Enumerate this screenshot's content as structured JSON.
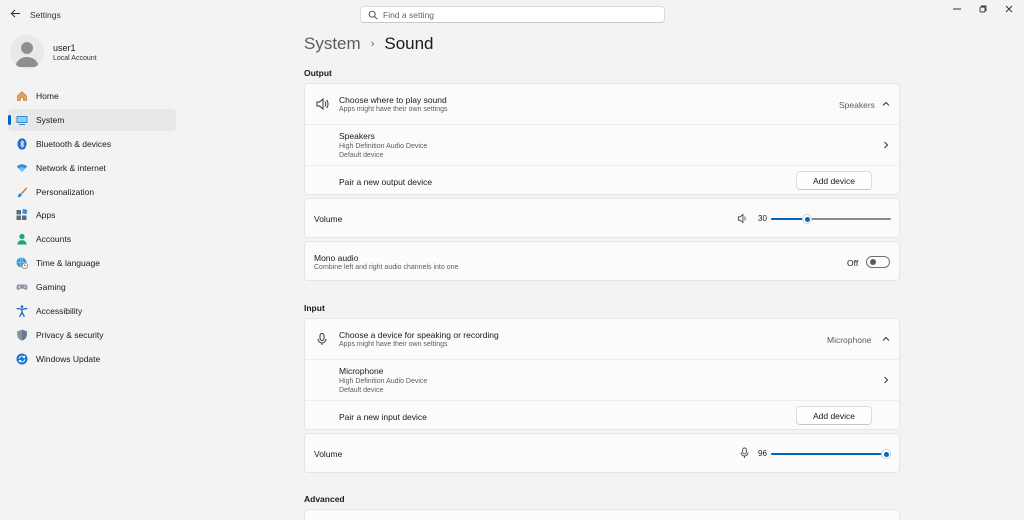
{
  "titlebar": {
    "app_title": "Settings",
    "search_placeholder": "Find a setting"
  },
  "profile": {
    "name": "user1",
    "account_type": "Local Account"
  },
  "nav": [
    {
      "id": "home",
      "label": "Home",
      "icon": "home-icon"
    },
    {
      "id": "system",
      "label": "System",
      "icon": "system-display-icon",
      "active": true
    },
    {
      "id": "bluetooth",
      "label": "Bluetooth & devices",
      "icon": "bluetooth-icon"
    },
    {
      "id": "network",
      "label": "Network & internet",
      "icon": "wifi-icon"
    },
    {
      "id": "personalization",
      "label": "Personalization",
      "icon": "paintbrush-icon"
    },
    {
      "id": "apps",
      "label": "Apps",
      "icon": "apps-icon"
    },
    {
      "id": "accounts",
      "label": "Accounts",
      "icon": "person-icon"
    },
    {
      "id": "time",
      "label": "Time & language",
      "icon": "globe-clock-icon"
    },
    {
      "id": "gaming",
      "label": "Gaming",
      "icon": "gamepad-icon"
    },
    {
      "id": "accessibility",
      "label": "Accessibility",
      "icon": "accessibility-icon"
    },
    {
      "id": "privacy",
      "label": "Privacy & security",
      "icon": "shield-icon"
    },
    {
      "id": "update",
      "label": "Windows Update",
      "icon": "update-icon"
    }
  ],
  "breadcrumb": {
    "parent": "System",
    "separator": "›",
    "current": "Sound"
  },
  "output": {
    "section_label": "Output",
    "choose_title": "Choose where to play sound",
    "choose_sub": "Apps might have their own settings",
    "choose_value": "Speakers",
    "device_name": "Speakers",
    "device_detail": "High Definition Audio Device",
    "device_status": "Default device",
    "pair_label": "Pair a new output device",
    "add_button": "Add device",
    "volume_label": "Volume",
    "volume_value": "30",
    "mono_title": "Mono audio",
    "mono_sub": "Combine left and right audio channels into one",
    "mono_state": "Off"
  },
  "input": {
    "section_label": "Input",
    "choose_title": "Choose a device for speaking or recording",
    "choose_sub": "Apps might have their own settings",
    "choose_value": "Microphone",
    "device_name": "Microphone",
    "device_detail": "High Definition Audio Device",
    "device_status": "Default device",
    "pair_label": "Pair a new input device",
    "add_button": "Add device",
    "volume_label": "Volume",
    "volume_value": "96"
  },
  "advanced": {
    "section_label": "Advanced"
  },
  "colors": {
    "accent": "#0067c0",
    "background": "#f3f3f3",
    "card": "#fbfbfb"
  }
}
